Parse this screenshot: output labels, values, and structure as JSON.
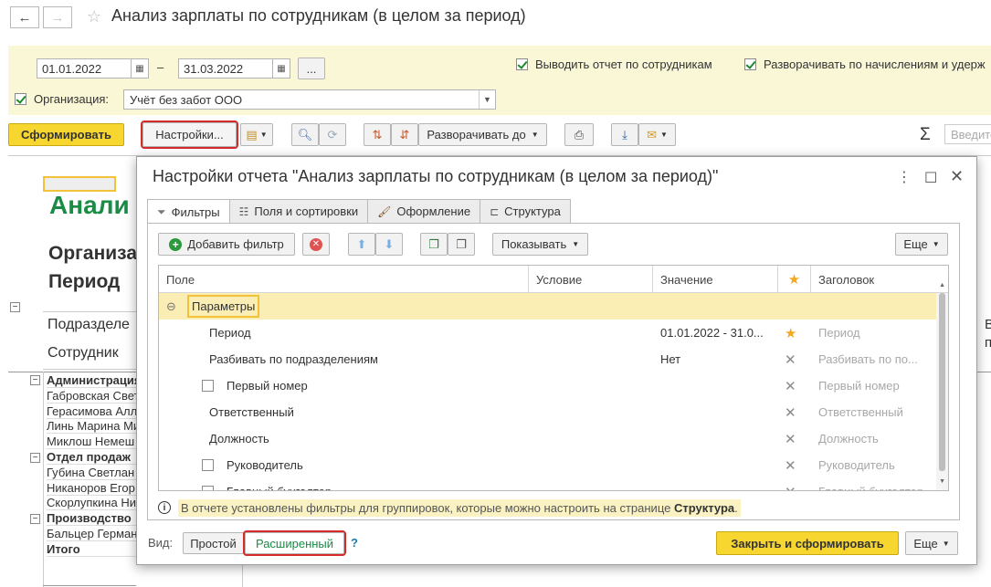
{
  "header": {
    "back_icon": "←",
    "forward_icon": "→",
    "star_icon": "☆",
    "title": "Анализ зарплаты по сотрудникам (в целом за период)"
  },
  "params": {
    "date_from": "01.01.2022",
    "date_dash": "–",
    "date_to": "31.03.2022",
    "more_btn": "...",
    "chk_by_employees": "Выводить отчет по сотрудникам",
    "chk_expand": "Разворачивать по начислениям и удерж",
    "org_label": "Организация:",
    "org_value": "Учёт без забот ООО"
  },
  "toolbar": {
    "generate": "Сформировать",
    "settings": "Настройки...",
    "expand_to": "Разворачивать до",
    "sigma": "Σ",
    "input_placeholder": "Введите"
  },
  "report": {
    "title_fragment": "Анали",
    "org_fragment": "Организа",
    "period_fragment": "Период",
    "col_division": "Подразделе",
    "col_employee": "Сотрудник",
    "right_fragment_1": "В",
    "right_fragment_2": "п",
    "rows": [
      {
        "text": "Администрация",
        "bold": true
      },
      {
        "text": "Габровская Свет",
        "bold": false
      },
      {
        "text": "Герасимова Алл",
        "bold": false
      },
      {
        "text": "Линь Марина Ми",
        "bold": false
      },
      {
        "text": "Миклош Немеш",
        "bold": false
      },
      {
        "text": "Отдел продаж",
        "bold": true
      },
      {
        "text": "Губина Светлан",
        "bold": false
      },
      {
        "text": "Никаноров Егор",
        "bold": false
      },
      {
        "text": "Скорлупкина Ни",
        "bold": false
      },
      {
        "text": "Производство",
        "bold": true
      },
      {
        "text": "Бальцер Герман",
        "bold": false
      },
      {
        "text": "Итого",
        "bold": true
      }
    ]
  },
  "dialog": {
    "title": "Настройки отчета \"Анализ зарплаты по сотрудникам (в целом за период)\"",
    "tabs": [
      {
        "label": "Фильтры",
        "icon": "filter-icon"
      },
      {
        "label": "Поля и сортировки",
        "icon": "fields-icon"
      },
      {
        "label": "Оформление",
        "icon": "brush-icon"
      },
      {
        "label": "Структура",
        "icon": "structure-icon"
      }
    ],
    "add_filter": "Добавить фильтр",
    "show": "Показывать",
    "more": "Еще",
    "columns": {
      "field": "Поле",
      "condition": "Условие",
      "value": "Значение",
      "header": "Заголовок"
    },
    "group_row": "Параметры",
    "rows": [
      {
        "field": "Период",
        "checkbox": false,
        "value": "01.01.2022 - 31.0...",
        "mark": "star",
        "header": "Период"
      },
      {
        "field": "Разбивать по подразделениям",
        "checkbox": false,
        "value": "Нет",
        "mark": "x",
        "header": "Разбивать по по..."
      },
      {
        "field": "Первый номер",
        "checkbox": true,
        "value": "",
        "mark": "x",
        "header": "Первый номер"
      },
      {
        "field": "Ответственный",
        "checkbox": false,
        "value": "",
        "mark": "x",
        "header": "Ответственный"
      },
      {
        "field": "Должность",
        "checkbox": false,
        "value": "",
        "mark": "x",
        "header": "Должность"
      },
      {
        "field": "Руководитель",
        "checkbox": true,
        "value": "",
        "mark": "x",
        "header": "Руководитель"
      },
      {
        "field": "Главный бухгалтер",
        "checkbox": true,
        "value": "",
        "mark": "x",
        "header": "Главный бухгалтер"
      }
    ],
    "info_prefix": "В отчете установлены фильтры для группировок, которые можно настроить на странице ",
    "info_link": "Структура",
    "info_suffix": ".",
    "view_label": "Вид:",
    "view_simple": "Простой",
    "view_extended": "Расширенный",
    "help": "?",
    "close_generate": "Закрыть и сформировать",
    "more_bottom": "Еще"
  },
  "colors": {
    "accent_yellow": "#f7d630",
    "params_bg": "#faf7d7",
    "report_green": "#1a8c46",
    "highlight_red": "#d42a2a"
  }
}
